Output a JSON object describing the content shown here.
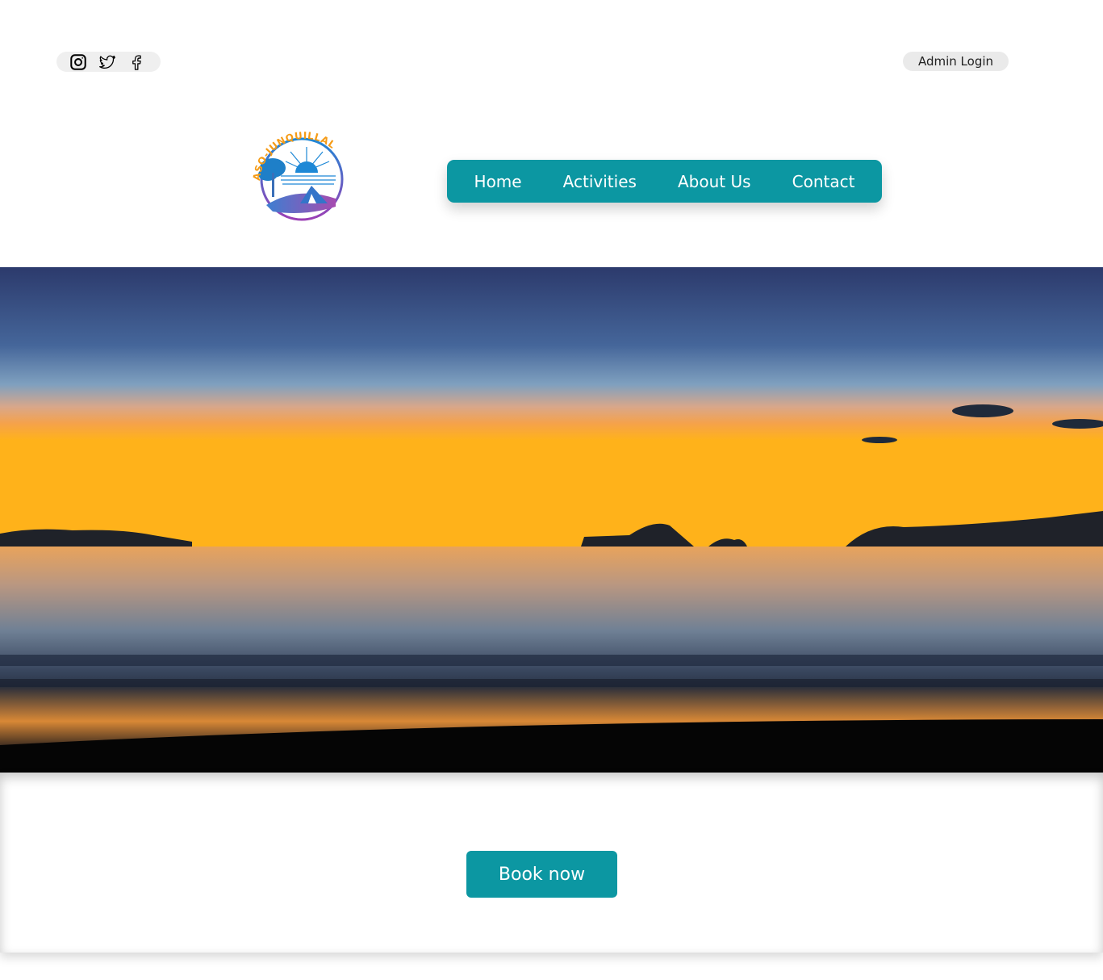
{
  "social": {
    "icons": [
      "instagram-icon",
      "twitter-icon",
      "facebook-icon"
    ]
  },
  "header": {
    "admin_login_label": "Admin Login"
  },
  "logo": {
    "text": "ASO-JUNQUILLAL"
  },
  "nav": {
    "items": [
      {
        "label": "Home"
      },
      {
        "label": "Activities"
      },
      {
        "label": "About Us"
      },
      {
        "label": "Contact"
      }
    ]
  },
  "hero": {
    "subject": "sunset over the ocean"
  },
  "cta": {
    "book_label": "Book now"
  },
  "colors": {
    "accent": "#0c97a2",
    "pill_bg": "#efefef"
  }
}
